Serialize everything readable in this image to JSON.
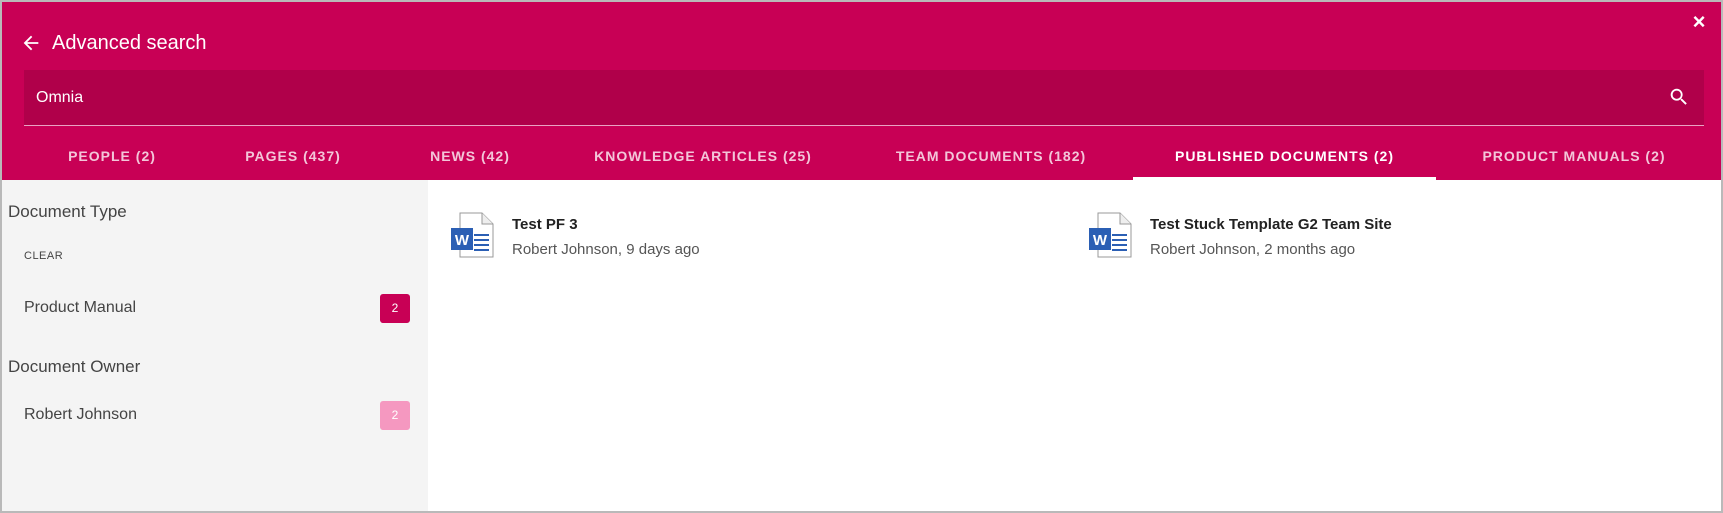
{
  "header": {
    "title": "Advanced search",
    "close_label": "×",
    "icons": {
      "back": "arrow-left-icon",
      "close": "close-icon",
      "search": "search-icon"
    }
  },
  "search": {
    "value": "Omnia",
    "placeholder": ""
  },
  "tabs": [
    {
      "label": "PEOPLE (2)",
      "active": false
    },
    {
      "label": "PAGES (437)",
      "active": false
    },
    {
      "label": "NEWS (42)",
      "active": false
    },
    {
      "label": "KNOWLEDGE ARTICLES (25)",
      "active": false
    },
    {
      "label": "TEAM DOCUMENTS (182)",
      "active": false
    },
    {
      "label": "PUBLISHED DOCUMENTS (2)",
      "active": true
    },
    {
      "label": "PRODUCT MANUALS (2)",
      "active": false
    }
  ],
  "filters": {
    "document_type": {
      "title": "Document Type",
      "clear_label": "CLEAR",
      "items": [
        {
          "label": "Product Manual",
          "count": "2",
          "selected": true
        }
      ]
    },
    "document_owner": {
      "title": "Document Owner",
      "items": [
        {
          "label": "Robert Johnson",
          "count": "2",
          "selected": false
        }
      ]
    }
  },
  "results": [
    {
      "title": "Test PF 3",
      "meta": "Robert Johnson, 9 days ago",
      "icon": "word-document-icon"
    },
    {
      "title": "Test Stuck Template G2 Team Site",
      "meta": "Robert Johnson, 2 months ago",
      "icon": "word-document-icon"
    }
  ],
  "colors": {
    "brand": "#c80055",
    "search_bg": "#b0004a",
    "badge_selected": "#c80055",
    "badge_unselected": "#f598c0",
    "word_blue": "#2b5fb4"
  }
}
